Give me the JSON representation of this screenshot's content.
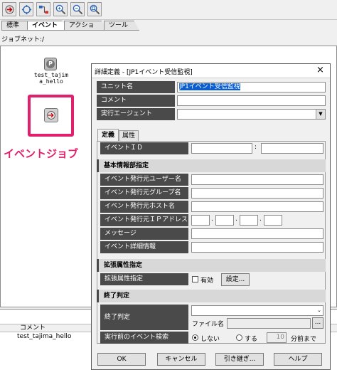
{
  "toolbar": {
    "icons": [
      "edit-mode-icon",
      "exec-mode-icon",
      "jobnet-graph-icon",
      "zoom-in-icon",
      "zoom-out-icon",
      "zoom-fit-icon"
    ]
  },
  "tabs": [
    {
      "label": "標準"
    },
    {
      "label": "イベント"
    },
    {
      "label": "アクション"
    },
    {
      "label": "ツール"
    }
  ],
  "jobnet": {
    "label": "ジョブネット:",
    "path": "/"
  },
  "canvas": {
    "job_name": "test_tajim\na_hello",
    "annotation": "イベントジョブ"
  },
  "bottom": {
    "header_comment": "コメント",
    "row_name": "test_tajima_hello"
  },
  "dialog": {
    "title": "詳細定義 - [JP1イベント受信監視]",
    "unit_name_label": "ユニット名",
    "unit_name_value": "JP1イベント受信監視",
    "comment_label": "コメント",
    "comment_value": "",
    "agent_label": "実行エージェント",
    "agent_value": "",
    "tab_definition": "定義",
    "tab_attribute": "属性",
    "event_id_label": "イベントＩＤ",
    "event_id_sep": ":",
    "section_basic": "基本情報部指定",
    "user_label": "イベント発行元ユーザー名",
    "group_label": "イベント発行元グループ名",
    "host_label": "イベント発行元ホスト名",
    "ip_label": "イベント発行元ＩＰアドレス",
    "message_label": "メッセージ",
    "detail_label": "イベント詳細情報",
    "section_ext": "拡張属性指定",
    "ext_label": "拡張属性指定",
    "ext_enabled_label": "有効",
    "ext_settings_button": "設定...",
    "section_end": "終了判定",
    "end_label": "終了判定",
    "file_name_label": "ファイル名",
    "browse_button": "...",
    "pre_event_label": "実行前のイベント検索",
    "radio_no": "しない",
    "radio_yes": "する",
    "minutes_value": "10",
    "minutes_suffix": "分前まで",
    "ok_button": "OK",
    "cancel_button": "キャンセル",
    "inherit_button": "引き継ぎ...",
    "help_button": "ヘルプ",
    "close_glyph": "×"
  },
  "colors": {
    "label_bg": "#4a4a4a",
    "highlight": "#e0206b",
    "selection": "#0a5fd0"
  }
}
